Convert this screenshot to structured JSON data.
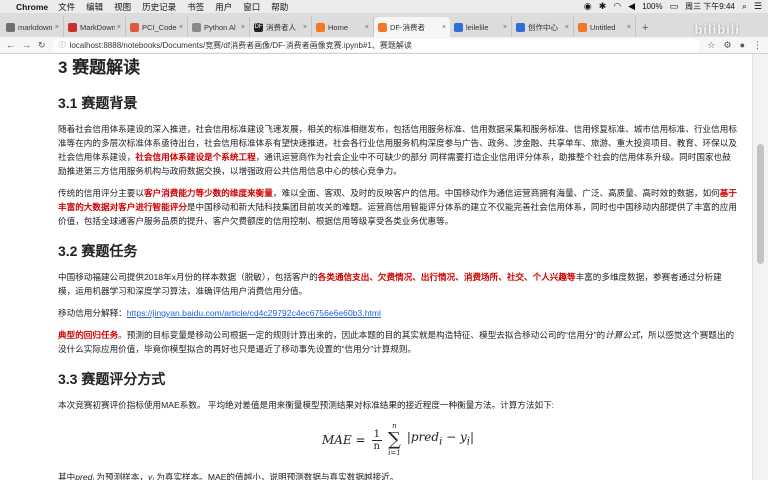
{
  "menubar": {
    "app": "Chrome",
    "items": [
      "文件",
      "编辑",
      "视图",
      "历史记录",
      "书签",
      "用户",
      "窗口",
      "帮助"
    ],
    "battery": "100%",
    "clock": "周三 下午9:44"
  },
  "tabs": [
    {
      "title": "markdown",
      "color": "#6f6f6f"
    },
    {
      "title": "MarkDown",
      "color": "#c8322c"
    },
    {
      "title": "PCI_Code",
      "color": "#e2583e"
    },
    {
      "title": "Python Al",
      "color": "#888888"
    },
    {
      "title": "消费者人",
      "color": "#222222"
    },
    {
      "title": "Home",
      "color": "#f37726"
    },
    {
      "title": "DF-消费者",
      "color": "#f37726"
    },
    {
      "title": "leilelile",
      "color": "#2c6fd6"
    },
    {
      "title": "创作中心",
      "color": "#2c6fd6"
    },
    {
      "title": "Untitled",
      "color": "#f37726"
    }
  ],
  "address": {
    "url": "localhost:8888/notebooks/Documents/竞赛/df消费者画像/DF-消费者画像竞赛.ipynb#1、赛题解读"
  },
  "watermark": "bilibili",
  "doc": {
    "h1": "3  赛题解读",
    "s1": {
      "h": "3.1  赛题背景",
      "p1a": "随着社会信用体系建设的深入推进，社会信用标准建设飞速发展，相关的标准相继发布，包括信用服务标准、信用数据采集和服务标准、信用修复标准、城市信用标准、行业信用标准等在内的多层次标准体系亟待出台，社会信用标准体系有望快速推进。社会各行业信用服务机构深度参与广告、政务、涉金融、共享单车、旅游、重大投资项目、教育、环保以及社会信用体系建设，",
      "p1red": "社会信用体系建设是个系统工程",
      "p1b": "，通讯运营商作为社会企业中不可缺少的部分 同样需要打造企业信用评分体系，助推整个社会的信用体系升级。同时国家也鼓励推进第三方信用服务机构与政府数据交换，以增强政府公共信用信息中心的核心竞争力。",
      "p2a": "传统的信用评分主要以",
      "p2red1": "客户消费能力等少数的维度来衡量",
      "p2b": "，难以全面、客观、及时的反映客户的信用。中国移动作为通信运营商拥有海量、广泛、高质量、高时效的数据，如何",
      "p2red2": "基于丰富的大数据对客户进行智能评分",
      "p2c": "是中国移动和新大陆科技集团目前攻关的难题。运营商信用智能评分体系的建立不仅能完善社会信用体系，同时也中国移动内部提供了丰富的应用价值，包括全球通客户服务品质的提升、客户欠费额度的信用控制、根据信用等级享受各类业务优惠等。"
    },
    "s2": {
      "h": "3.2  赛题任务",
      "p1a": "中国移动福建公司提供2018年x月份的样本数据（脱敏），包括客户的",
      "p1red": "各类通信支出、欠费情况、出行情况、消费场所、社交、个人兴趣等",
      "p1b": "丰富的多维度数据，参赛者通过分析建模，运用机器学习和深度学习算法，准确评估用户消费信用分值。",
      "p2label": "移动信用分解释：",
      "p2link": "https://jingyan.baidu.com/article/cd4c29792c4ec6756e6e60b3.html",
      "p3red": "典型的回归任务",
      "p3a": "。预测的目标变量是移动公司根据一定的规则计算出来的，因此本题的目的其实就是构造特征、模型去拟合移动公司的“信用分”的",
      "p3ital": "计算公式",
      "p3b": "，所以感觉这个赛题出的没什么实际应用价值，毕竟你模型拟合的再好也只是逼近了移动事先设置的“信用分”计算规则。"
    },
    "s3": {
      "h": "3.3  赛题评分方式",
      "p1": "本次竞赛初赛评价指标使用MAE系数。 平均绝对差值是用来衡量模型预测结果对标准结果的接近程度一种衡量方法。计算方法如下:",
      "formula_lhs": "MAE =",
      "formula_num": "1",
      "formula_den": "n",
      "sum_top": "n",
      "sum_bot": "i=1",
      "formula_body": "|pred",
      "formula_sub": "i",
      "formula_minus": " − y",
      "formula_sub2": "i",
      "formula_end": "|",
      "p2a": "其中",
      "p2b": "pred",
      "p2c": "为预测样本，",
      "p2d": "y",
      "p2e": "为真实样本。MAE的值越小，说明预测数据与真实数据越接近。"
    }
  }
}
